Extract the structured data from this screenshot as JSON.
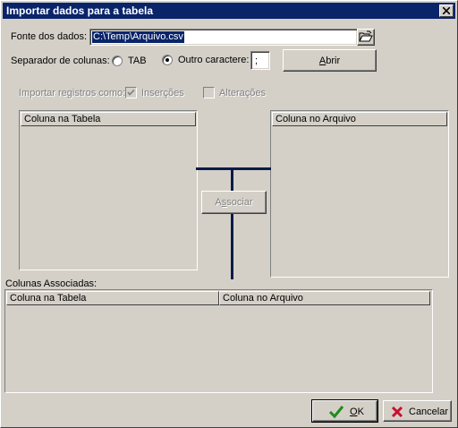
{
  "window": {
    "title": "Importar dados para a tabela"
  },
  "source": {
    "label": "Fonte dos dados:",
    "value": "C:\\Temp\\Arquivo.csv"
  },
  "separator": {
    "label": "Separador de colunas:",
    "tab_label": "TAB",
    "other_label": "Outro caractere:",
    "other_value": ";",
    "selected": "other"
  },
  "open_button": {
    "label_pre": "",
    "label_hot": "A",
    "label_post": "brir"
  },
  "import_mode": {
    "label": "Importar registros como:",
    "inserts_label": "Inserções",
    "updates_label": "Alterações"
  },
  "left_list": {
    "header": "Coluna na Tabela"
  },
  "right_list": {
    "header": "Coluna no Arquivo"
  },
  "associate_button": {
    "label_pre": "A",
    "label_hot": "s",
    "label_post": "sociar"
  },
  "associated": {
    "label": "Colunas Associadas:",
    "col1": "Coluna na Tabela",
    "col2": "Coluna no Arquivo"
  },
  "ok_button": {
    "label_hot": "O",
    "label_post": "K"
  },
  "cancel_button": {
    "label": "Cancelar"
  },
  "icons": {
    "close": "close-icon",
    "browse": "folder-open-icon",
    "ok": "checkmark-icon",
    "cancel": "x-icon"
  },
  "colors": {
    "title_bar": "#0a246a",
    "connector": "#0a1a4a",
    "ok_check": "#1e8c1e",
    "cancel_x": "#c8102e"
  }
}
